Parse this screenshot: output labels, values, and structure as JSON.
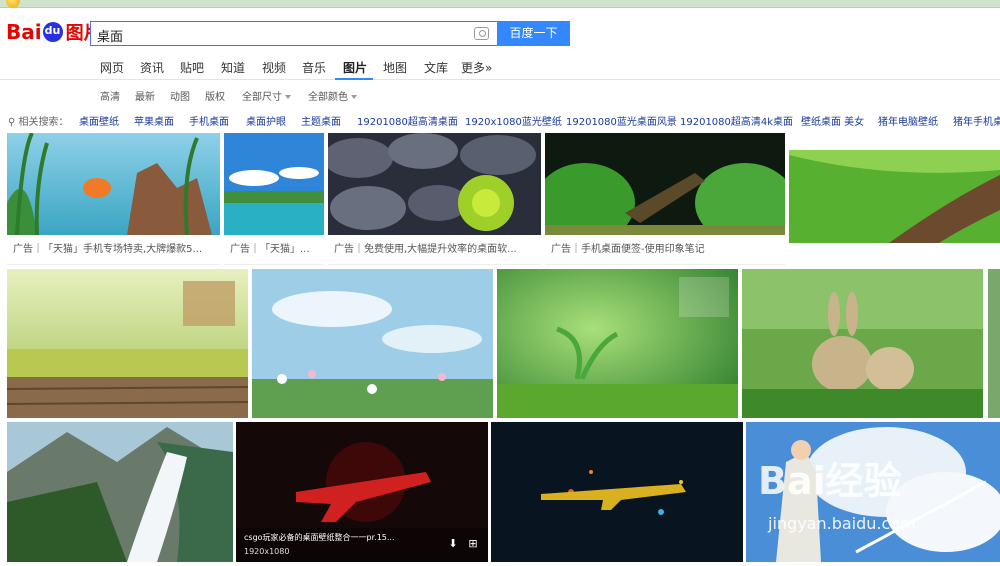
{
  "brand": {
    "logo_part1": "Bai",
    "logo_part2": "图片"
  },
  "search": {
    "query": "桌面",
    "button": "百度一下"
  },
  "tabs": [
    {
      "label": "网页"
    },
    {
      "label": "资讯"
    },
    {
      "label": "贴吧"
    },
    {
      "label": "知道"
    },
    {
      "label": "视频"
    },
    {
      "label": "音乐"
    },
    {
      "label": "图片",
      "active": true
    },
    {
      "label": "地图"
    },
    {
      "label": "文库"
    },
    {
      "label": "更多»"
    }
  ],
  "filters": [
    "高清",
    "最新",
    "动图",
    "版权",
    "全部尺寸",
    "全部颜色"
  ],
  "related": {
    "label": "相关搜索：",
    "items": [
      "桌面壁纸",
      "苹果桌面",
      "手机桌面",
      "桌面护眼",
      "主题桌面",
      "19201080超高清桌面",
      "1920x1080蓝光壁纸",
      "19201080蓝光桌面风景",
      "19201080超高清4k桌面",
      "壁纸桌面 美女",
      "猪年电脑壁纸",
      "猪年手机桌"
    ]
  },
  "ads": [
    {
      "caption": "广告｜「天猫」手机专场特卖,大牌爆款5..."
    },
    {
      "caption": "广告｜「天猫」..."
    },
    {
      "caption": "广告｜免费使用,大幅提升效率的桌面软..."
    },
    {
      "caption": "广告｜手机桌面便签-使用印象笔记"
    }
  ],
  "hover_card": {
    "title": "csgo玩家必备的桌面壁纸整合一一pr.15...",
    "size": "1920x1080"
  },
  "watermark": {
    "text": "Bai经验",
    "url": "jingyan.baidu.com"
  },
  "images": [
    {
      "name": "image-aquarium-goldfish",
      "icon": "image-icon"
    },
    {
      "name": "image-lake-blue-sky",
      "icon": "image-icon"
    },
    {
      "name": "image-pebbles-chrysanthemum",
      "icon": "image-icon"
    },
    {
      "name": "image-aquarium-plants",
      "icon": "image-icon"
    },
    {
      "name": "image-green-field",
      "icon": "image-icon"
    },
    {
      "name": "image-calendar-wood-grass",
      "icon": "image-icon"
    },
    {
      "name": "image-flowers-sky",
      "icon": "image-icon"
    },
    {
      "name": "image-sprout-calendar",
      "icon": "image-icon"
    },
    {
      "name": "image-rabbits-grass",
      "icon": "image-icon"
    },
    {
      "name": "image-waterfall-mountains",
      "icon": "image-icon"
    },
    {
      "name": "image-csgo-red-rifle",
      "icon": "image-icon"
    },
    {
      "name": "image-csgo-gold-rifle",
      "icon": "image-icon"
    },
    {
      "name": "image-anime-clouds",
      "icon": "image-icon"
    }
  ]
}
